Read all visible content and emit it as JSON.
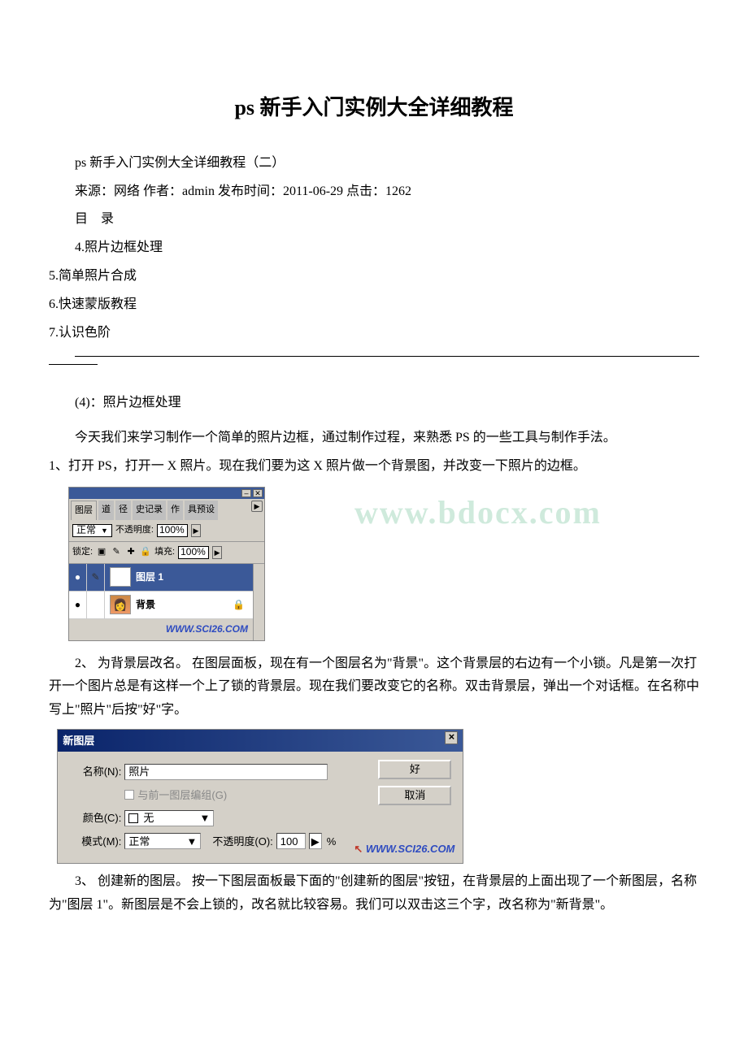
{
  "title": "ps 新手入门实例大全详细教程",
  "subtitle": "ps 新手入门实例大全详细教程（二）",
  "sourceLine": "来源：网络 作者：admin 发布时间：2011-06-29 点击：1262",
  "tocHeading": "目　录",
  "toc": [
    "4.照片边框处理",
    "5.简单照片合成",
    "6.快速蒙版教程",
    "7.认识色阶"
  ],
  "sectionHeading": "(4)：照片边框处理",
  "para1": "今天我们来学习制作一个简单的照片边框，通过制作过程，来熟悉 PS 的一些工具与制作手法。",
  "step1": "1、打开 PS，打开一 X 照片。现在我们要为这 X 照片做一个背景图，并改变一下照片的边框。",
  "watermark": "www.bdocx.com",
  "layersPanel": {
    "tabs": [
      "图层",
      "道",
      "径",
      "史记录",
      "作",
      "具预设"
    ],
    "blendMode": "正常",
    "opacityLabel": "不透明度:",
    "opacityValue": "100%",
    "lockLabel": "锁定:",
    "fillLabel": "填充:",
    "fillValue": "100%",
    "layer1": "图层 1",
    "bg": "背景",
    "footerWm": "WWW.SCI26.COM"
  },
  "step2": "2、 为背景层改名。 在图层面板，现在有一个图层名为\"背景\"。这个背景层的右边有一个小锁。凡是第一次打开一个图片总是有这样一个上了锁的背景层。现在我们要改变它的名称。双击背景层，弹出一个对话框。在名称中写上\"照片\"后按\"好\"字。",
  "dialog": {
    "title": "新图层",
    "nameLabel": "名称(N):",
    "nameValue": "照片",
    "groupLabel": "与前一图层编组(G)",
    "colorLabel": "颜色(C):",
    "colorValue": "无",
    "modeLabel": "模式(M):",
    "modeValue": "正常",
    "opLabel": "不透明度(O):",
    "opValue": "100",
    "ok": "好",
    "cancel": "取消",
    "wm": "WWW.SCI26.COM"
  },
  "step3": "3、 创建新的图层。 按一下图层面板最下面的\"创建新的图层\"按钮，在背景层的上面出现了一个新图层，名称为\"图层 1\"。新图层是不会上锁的，改名就比较容易。我们可以双击这三个字，改名称为\"新背景\"。",
  "icons": {
    "pct": "%",
    "tri": "▶",
    "eye": "👁",
    "brush": "✎",
    "lock": "🔒",
    "close": "×",
    "min": "–",
    "cross": "✕",
    "plus": "✚",
    "down": "▼"
  }
}
